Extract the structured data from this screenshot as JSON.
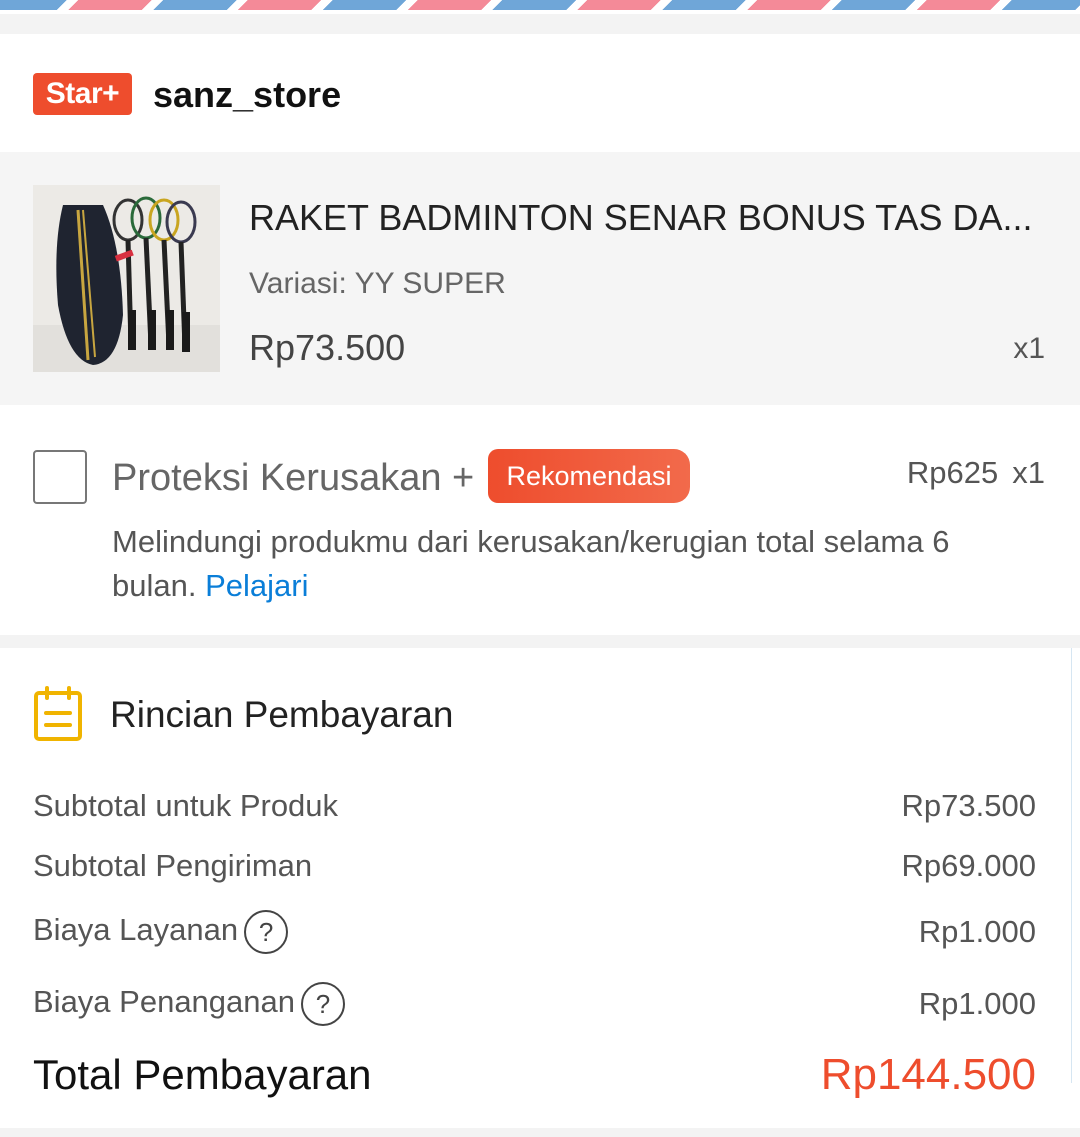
{
  "store": {
    "badge": "Star+",
    "name": "sanz_store"
  },
  "product": {
    "title": "RAKET BADMINTON SENAR BONUS TAS DA...",
    "variant": "Variasi: YY SUPER",
    "price": "Rp73.500",
    "qty": "x1"
  },
  "protection": {
    "checked": false,
    "title": "Proteksi Kerusakan +",
    "badge": "Rekomendasi",
    "price": "Rp625",
    "qty": "x1",
    "description": "Melindungi produkmu dari kerusakan/kerugian total selama 6 bulan. ",
    "link": "Pelajari"
  },
  "payment": {
    "heading": "Rincian Pembayaran",
    "rows": [
      {
        "label": "Subtotal untuk Produk",
        "value": "Rp73.500",
        "help": false
      },
      {
        "label": "Subtotal Pengiriman",
        "value": "Rp69.000",
        "help": false
      },
      {
        "label": "Biaya Layanan",
        "value": "Rp1.000",
        "help": true
      },
      {
        "label": "Biaya Penanganan",
        "value": "Rp1.000",
        "help": true
      }
    ],
    "total_label": "Total Pembayaran",
    "total_value": "Rp144.500",
    "help_glyph": "?"
  },
  "colors": {
    "accent": "#ee4d2d",
    "link": "#0a7ed8",
    "icon_yellow": "#f0b400"
  },
  "icons": {
    "payment_icon": "receipt-icon",
    "help_icon": "question-circle-icon"
  }
}
